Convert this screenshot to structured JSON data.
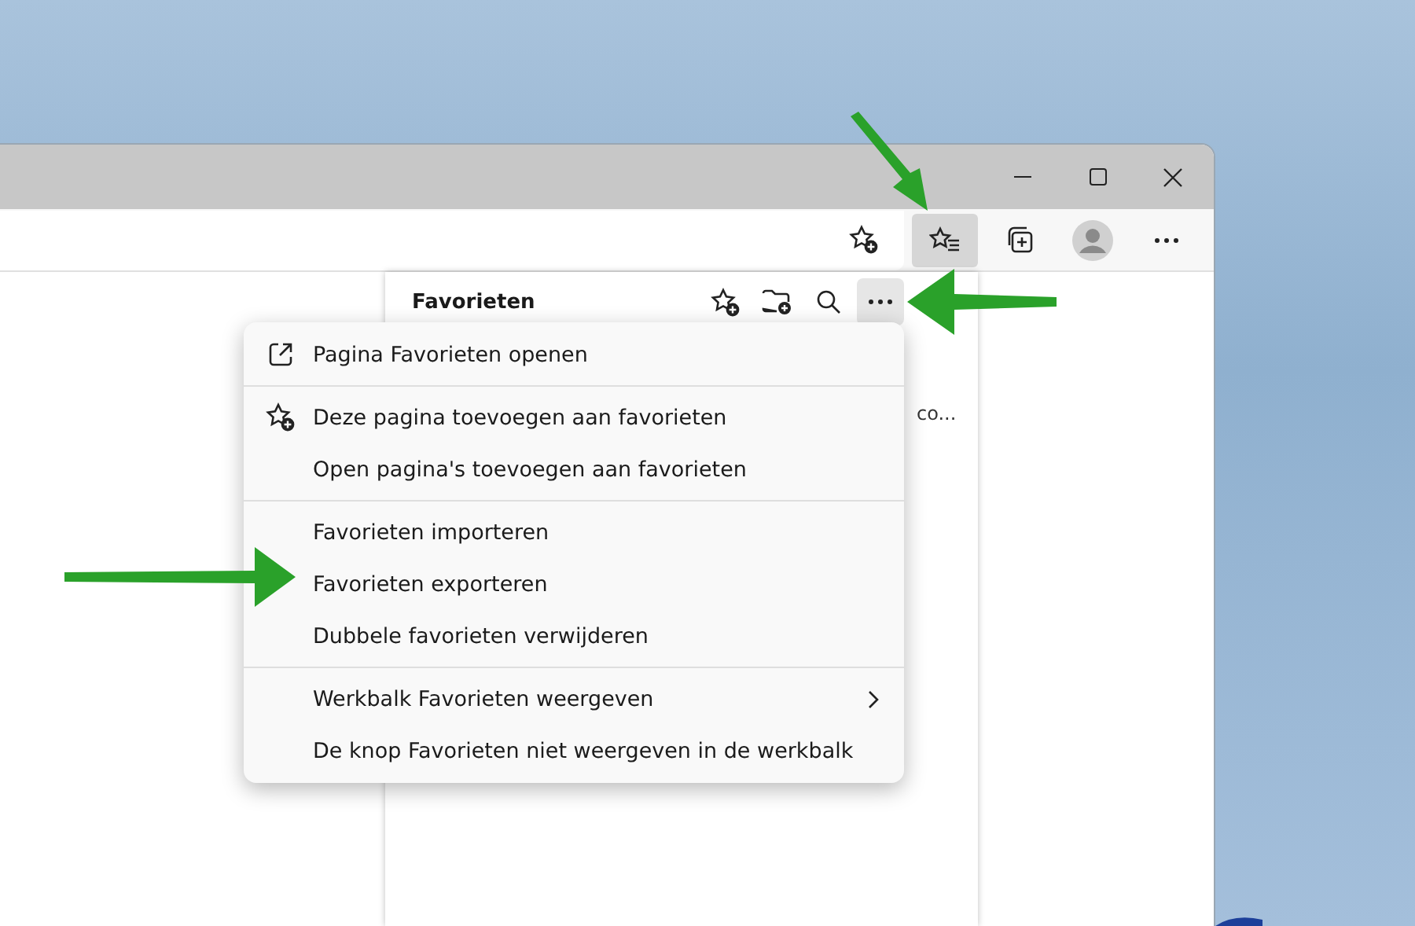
{
  "toolbar": {
    "buttons": [
      {
        "kind": "favorites",
        "selected": true
      },
      {
        "kind": "collections",
        "selected": false
      },
      {
        "kind": "profile",
        "selected": false
      },
      {
        "kind": "more",
        "selected": false
      }
    ]
  },
  "favorites_panel": {
    "title": "Favorieten",
    "more_selected": true,
    "item_text": "co..."
  },
  "menu": {
    "sections": [
      [
        {
          "label": "Pagina Favorieten openen",
          "kind": "open"
        }
      ],
      [
        {
          "label": "Deze pagina toevoegen aan favorieten",
          "kind": "add"
        },
        {
          "label": "Open pagina's toevoegen aan favorieten",
          "kind": "plain"
        }
      ],
      [
        {
          "label": "Favorieten importeren",
          "kind": "plain"
        },
        {
          "label": "Favorieten exporteren",
          "kind": "plain"
        },
        {
          "label": "Dubbele favorieten verwijderen",
          "kind": "plain"
        }
      ],
      [
        {
          "label": "Werkbalk Favorieten weergeven",
          "kind": "submenu"
        },
        {
          "label": "De knop Favorieten niet weergeven in de werkbalk",
          "kind": "plain"
        }
      ]
    ]
  }
}
